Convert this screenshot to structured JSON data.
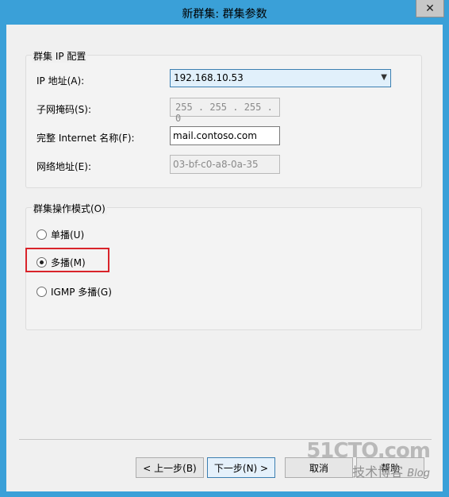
{
  "window": {
    "title": "新群集: 群集参数",
    "close_label": "✕"
  },
  "cluster_ip": {
    "group_title": "群集 IP 配置",
    "ip_label": "IP 地址(A):",
    "ip_value": "192.168.10.53",
    "subnet_label": "子网掩码(S):",
    "subnet_value": "255 . 255 . 255 .  0",
    "fqdn_label": "完整 Internet 名称(F):",
    "fqdn_value": "mail.contoso.com",
    "mac_label": "网络地址(E):",
    "mac_value": "03-bf-c0-a8-0a-35"
  },
  "mode": {
    "group_title": "群集操作模式(O)",
    "options": [
      "单播(U)",
      "多播(M)",
      "IGMP 多播(G)"
    ],
    "selected": "多播(M)"
  },
  "buttons": {
    "back": "< 上一步(B)",
    "next": "下一步(N) >",
    "cancel": "取消",
    "help": "帮助"
  },
  "watermark": {
    "line1": "51CTO.com",
    "line2": "技术博客",
    "line2b": "Blog"
  }
}
